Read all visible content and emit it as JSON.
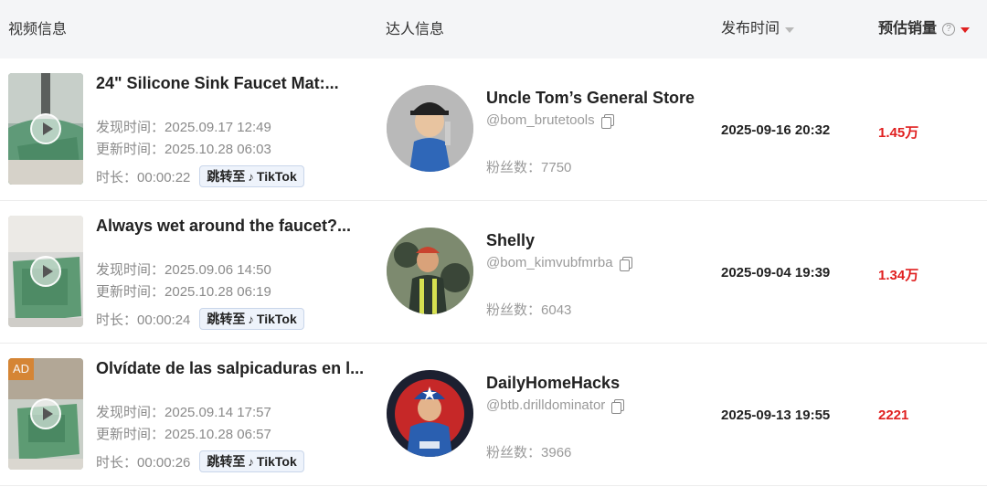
{
  "header": {
    "video_info": "视频信息",
    "creator_info": "达人信息",
    "publish_time": "发布时间",
    "estimated_sales": "预估销量",
    "help_icon": "?"
  },
  "labels": {
    "discovered": "发现时间：",
    "updated": "更新时间：",
    "duration": "时长：",
    "jump_to": "跳转至",
    "tiktok": "TikTok",
    "fans": "粉丝数："
  },
  "rows": [
    {
      "title": "24\" Silicone Sink Faucet Mat:...",
      "discovered": "2025.09.17 12:49",
      "updated": "2025.10.28 06:03",
      "duration": "00:00:22",
      "creator_name": "Uncle Tom’s General Store",
      "creator_handle": "@bom_brutetools",
      "fans": "7750",
      "publish_time": "2025-09-16 20:32",
      "sales": "1.45万"
    },
    {
      "title": "Always wet around the faucet?...",
      "discovered": "2025.09.06 14:50",
      "updated": "2025.10.28 06:19",
      "duration": "00:00:24",
      "creator_name": "Shelly",
      "creator_handle": "@bom_kimvubfmrba",
      "fans": "6043",
      "publish_time": "2025-09-04 19:39",
      "sales": "1.34万"
    },
    {
      "title": "Olvídate de las salpicaduras en l...",
      "ad_badge": "AD",
      "discovered": "2025.09.14 17:57",
      "updated": "2025.10.28 06:57",
      "duration": "00:00:26",
      "creator_name": "DailyHomeHacks",
      "creator_handle": "@btb.drilldominator",
      "fans": "3966",
      "publish_time": "2025-09-13 19:55",
      "sales": "2221"
    }
  ],
  "colors": {
    "accent_red": "#e02020",
    "header_bg": "#f4f5f7"
  }
}
